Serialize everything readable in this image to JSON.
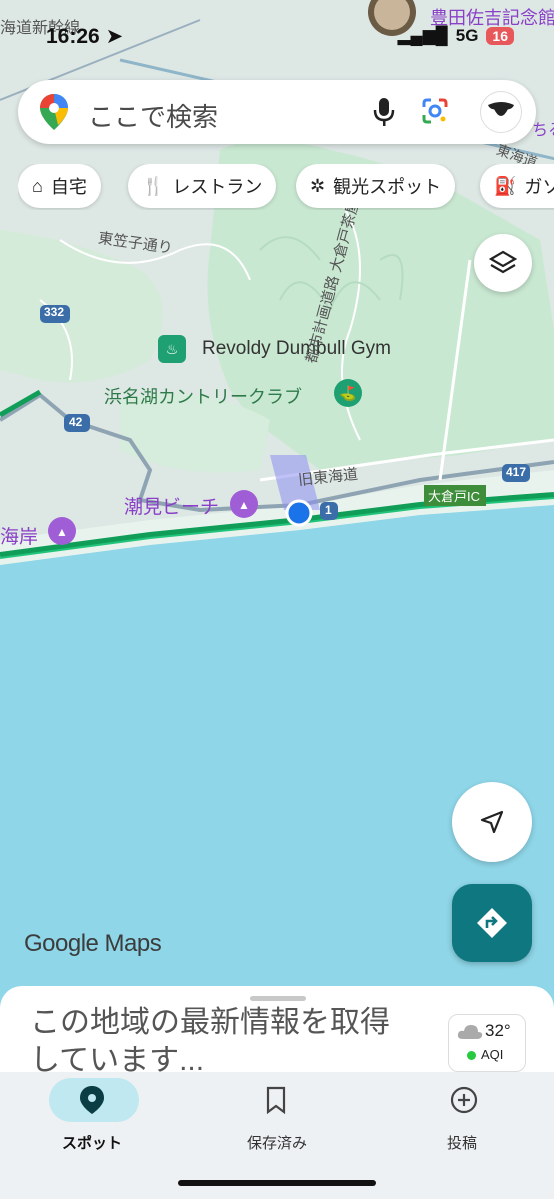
{
  "status_bar": {
    "time": "16:26",
    "network": "5G",
    "battery": "16"
  },
  "search": {
    "placeholder": "ここで検索"
  },
  "chips": [
    {
      "label": "自宅",
      "icon": "home-icon"
    },
    {
      "label": "レストラン",
      "icon": "fork-knife-icon"
    },
    {
      "label": "観光スポット",
      "icon": "ferris-wheel-icon"
    },
    {
      "label": "ガソ",
      "icon": "gas-station-icon"
    }
  ],
  "map": {
    "labels": {
      "top_right_place": "豊田佐吉記念館",
      "top_left_road": "海道新幹線",
      "higashi_kasago": "東笠子通り",
      "gym": "Revoldy Dumbull Gym",
      "country_club": "浜名湖カントリークラブ",
      "old_tokaido": "旧東海道",
      "beach": "潮見ビーチ",
      "coast": "海岸",
      "city_road": "都市計画道路 大倉戸茶屋松線",
      "ic": "大倉戸IC",
      "east_right": "東海道",
      "right_edge": "ちる"
    },
    "shields": {
      "r332": "332",
      "r42": "42",
      "r1": "1",
      "r417": "417"
    }
  },
  "sheet": {
    "updating_text": "この地域の最新情報を取得しています..."
  },
  "weather": {
    "temperature": "32°",
    "aqi": "AQI"
  },
  "branding": {
    "google_maps": "Google Maps"
  },
  "bottom_nav": [
    {
      "label": "スポット",
      "icon": "location-pin-icon",
      "active": true
    },
    {
      "label": "保存済み",
      "icon": "bookmark-icon",
      "active": false
    },
    {
      "label": "投稿",
      "icon": "add-circle-icon",
      "active": false
    }
  ],
  "colors": {
    "accent": "#0e7780",
    "sea": "#8ed6e8",
    "land": "#d9ece1",
    "park": "#c7e8cf",
    "active_pill": "#bfe8f0"
  }
}
